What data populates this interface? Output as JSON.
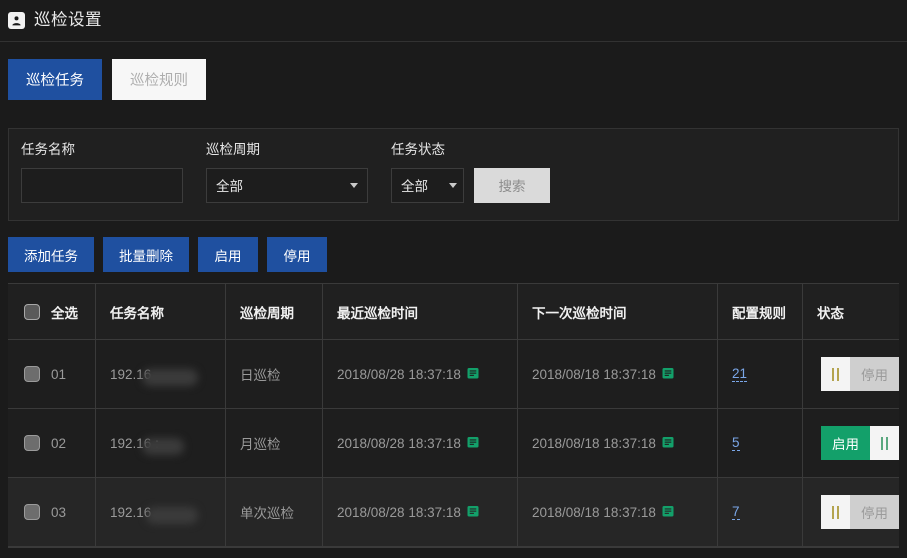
{
  "header": {
    "icon": "user-badge-icon",
    "title": "巡检设置"
  },
  "tabs": [
    {
      "label": "巡检任务",
      "active": true
    },
    {
      "label": "巡检规则",
      "active": false
    }
  ],
  "filters": {
    "task_name": {
      "label": "任务名称",
      "value": "",
      "placeholder": ""
    },
    "cycle": {
      "label": "巡检周期",
      "value": "全部",
      "options": [
        "全部"
      ]
    },
    "status": {
      "label": "任务状态",
      "value": "全部",
      "options": [
        "全部"
      ]
    },
    "search_button": "搜索"
  },
  "actions": [
    {
      "label": "添加任务"
    },
    {
      "label": "批量删除"
    },
    {
      "label": "启用"
    },
    {
      "label": "停用"
    }
  ],
  "table": {
    "columns": [
      "全选",
      "任务名称",
      "巡检周期",
      "最近巡检时间",
      "下一次巡检时间",
      "配置规则",
      "状态"
    ],
    "rows": [
      {
        "index": "01",
        "name": "192.16",
        "cycle": "日巡检",
        "last_time": "2018/08/28 18:37:18",
        "next_time": "2018/08/18 18:37:18",
        "rule_count": "21",
        "state": {
          "on": false,
          "label": "停用"
        }
      },
      {
        "index": "02",
        "name": "192.16",
        "name_suffix": ":",
        "cycle": "月巡检",
        "last_time": "2018/08/28 18:37:18",
        "next_time": "2018/08/18 18:37:18",
        "rule_count": "5",
        "state": {
          "on": true,
          "label": "启用"
        }
      },
      {
        "index": "03",
        "name": "192.16",
        "cycle": "单次巡检",
        "last_time": "2018/08/28 18:37:18",
        "next_time": "2018/08/18 18:37:18",
        "rule_count": "7",
        "state": {
          "on": false,
          "label": "停用"
        }
      }
    ]
  },
  "colors": {
    "accent_blue": "#1f50a0",
    "toggle_green": "#13a06a",
    "calendar_green": "#13a06a",
    "link_blue": "#7ba7e8",
    "page_bg": "#1b1b1b"
  }
}
